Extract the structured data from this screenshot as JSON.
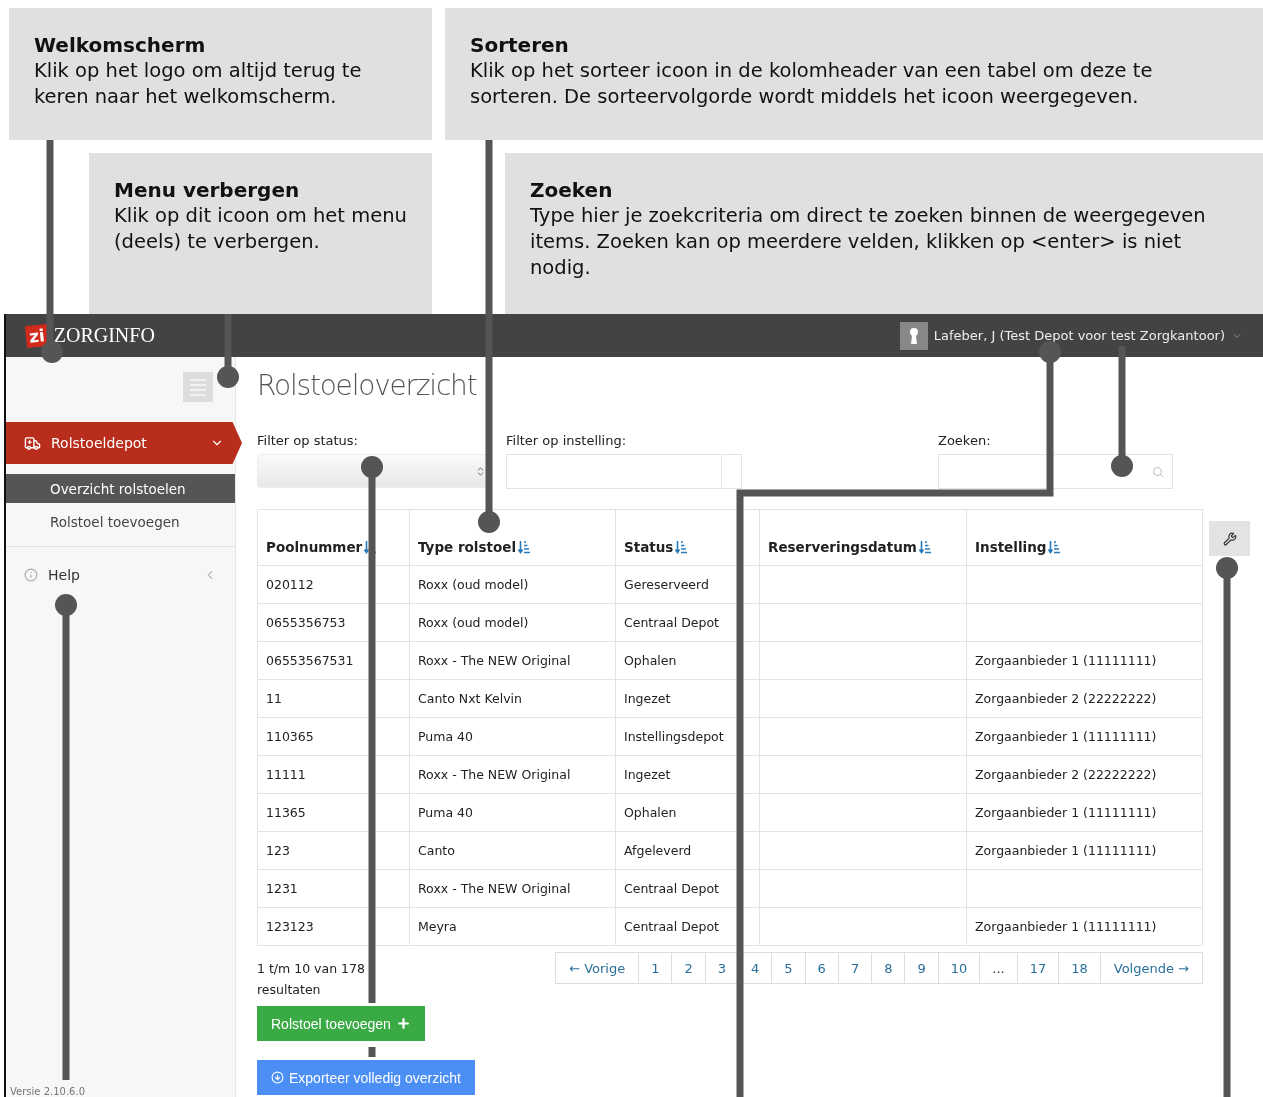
{
  "callouts": [
    {
      "title": "Welkomscherm",
      "text": "Klik op het logo om altijd terug te keren naar het welkomscherm."
    },
    {
      "title": "Menu verbergen",
      "text": "Klik op dit icoon om het menu (deels) te verbergen."
    },
    {
      "title": "Sorteren",
      "text": "Klik op het sorteer icoon in de kolomheader van een tabel om deze te sorteren. De sorteervolgorde wordt middels het icoon weergegeven."
    },
    {
      "title": "Zoeken",
      "text": "Type hier je zoekcriteria om direct te zoeken binnen de weergegeven items. Zoeken kan op meerdere velden, klikken op <enter> is niet nodig."
    }
  ],
  "app": {
    "header": {
      "logo_mark": "zi",
      "logo_text": "ZORGINFO",
      "user": "Lafeber, J (Test Depot voor test Zorgkantoor)"
    },
    "sidebar": {
      "items": [
        {
          "label": "Rolstoeldepot",
          "kind": "depot",
          "selected": true,
          "expanded": true,
          "children": [
            {
              "label": "Overzicht rolstoelen",
              "selected": true
            },
            {
              "label": "Rolstoel toevoegen",
              "selected": false
            }
          ]
        },
        {
          "label": "Help",
          "kind": "info",
          "selected": false,
          "expanded": false
        }
      ],
      "version": "Versie 2.10.6.0"
    },
    "title": "Rolstoeloverzicht",
    "filters": [
      {
        "label": "Filter op status:",
        "kind": "select"
      },
      {
        "label": "Filter op instelling:",
        "kind": "combo"
      },
      {
        "label": "Zoeken:",
        "kind": "search"
      }
    ],
    "table": {
      "columns": [
        {
          "label": "Poolnummer"
        },
        {
          "label": "Type rolstoel"
        },
        {
          "label": "Status"
        },
        {
          "label": "Reserveringsdatum"
        },
        {
          "label": "Instelling"
        }
      ],
      "rows": [
        [
          "020112",
          "Roxx (oud model)",
          "Gereserveerd",
          "",
          ""
        ],
        [
          "0655356753",
          "Roxx (oud model)",
          "Centraal Depot",
          "",
          ""
        ],
        [
          "06553567531",
          "Roxx - The NEW Original",
          "Ophalen",
          "",
          "Zorgaanbieder 1 (11111111)"
        ],
        [
          "11",
          "Canto Nxt Kelvin",
          "Ingezet",
          "",
          "Zorgaanbieder 2 (22222222)"
        ],
        [
          "110365",
          "Puma 40",
          "Instellingsdepot",
          "",
          "Zorgaanbieder 1 (11111111)"
        ],
        [
          "11111",
          "Roxx - The NEW Original",
          "Ingezet",
          "",
          "Zorgaanbieder 2 (22222222)"
        ],
        [
          "11365",
          "Puma 40",
          "Ophalen",
          "",
          "Zorgaanbieder 1 (11111111)"
        ],
        [
          "123",
          "Canto",
          "Afgeleverd",
          "",
          "Zorgaanbieder 1 (11111111)"
        ],
        [
          "1231",
          "Roxx - The NEW Original",
          "Centraal Depot",
          "",
          ""
        ],
        [
          "123123",
          "Meyra",
          "Centraal Depot",
          "",
          "Zorgaanbieder 1 (11111111)"
        ]
      ]
    },
    "results": "1 t/m 10 van 178 resultaten",
    "pagination": [
      {
        "label": "← Vorige",
        "kind": "nav"
      },
      {
        "label": "1",
        "kind": "page"
      },
      {
        "label": "2",
        "kind": "page"
      },
      {
        "label": "3",
        "kind": "page"
      },
      {
        "label": "4",
        "kind": "page"
      },
      {
        "label": "5",
        "kind": "page"
      },
      {
        "label": "6",
        "kind": "page"
      },
      {
        "label": "7",
        "kind": "page"
      },
      {
        "label": "8",
        "kind": "page"
      },
      {
        "label": "9",
        "kind": "page"
      },
      {
        "label": "10",
        "kind": "page"
      },
      {
        "label": "...",
        "kind": "ellipsis"
      },
      {
        "label": "17",
        "kind": "page"
      },
      {
        "label": "18",
        "kind": "page"
      },
      {
        "label": "Volgende →",
        "kind": "nav"
      }
    ],
    "buttons": [
      {
        "label": "Rolstoel toevoegen",
        "kind": "add"
      },
      {
        "label": "Exporteer volledig overzicht",
        "kind": "export"
      }
    ]
  }
}
